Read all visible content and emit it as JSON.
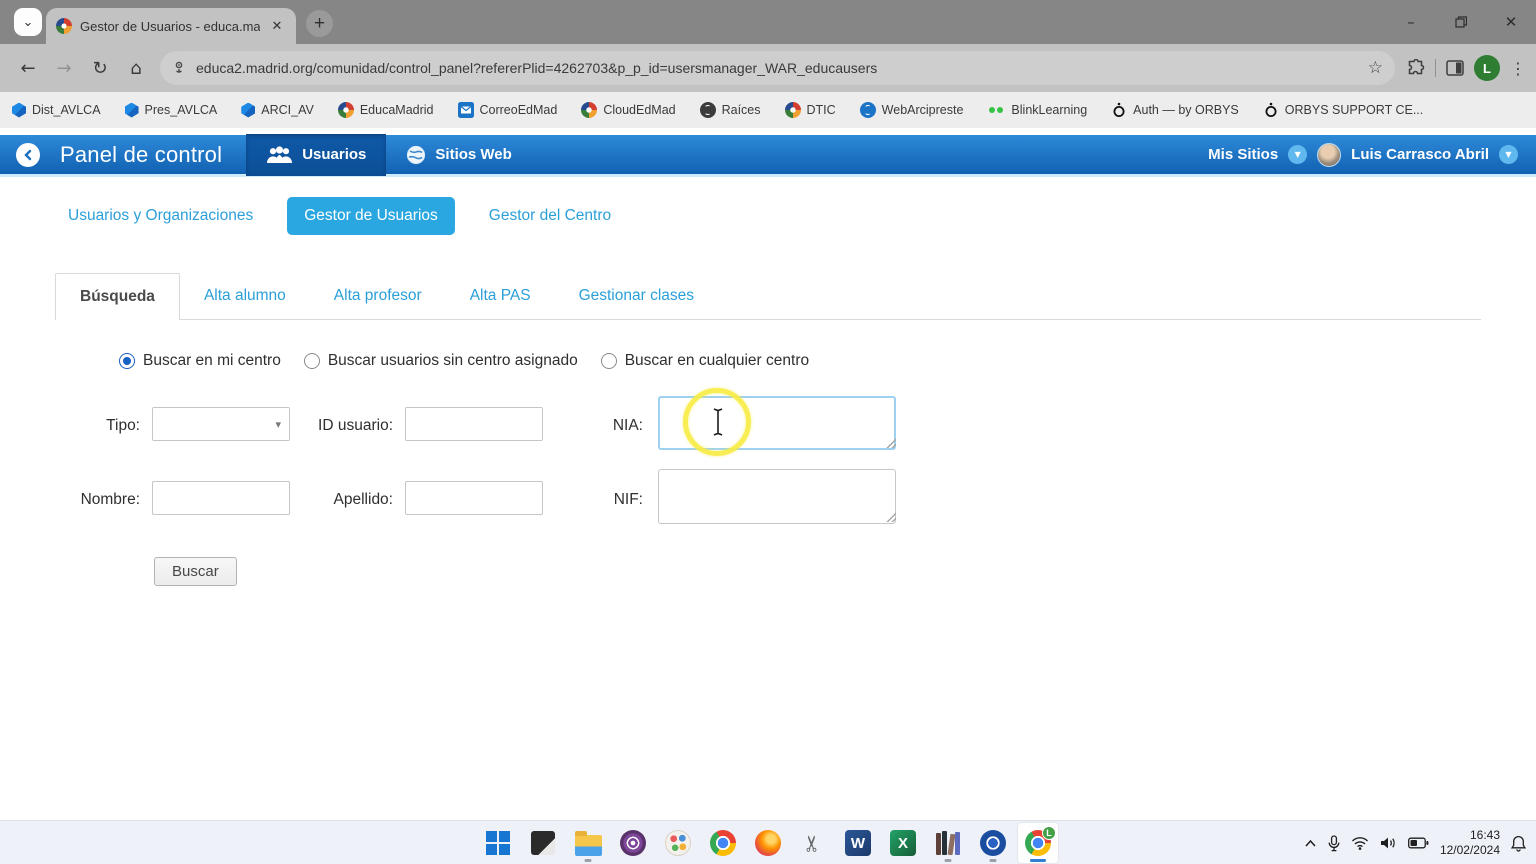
{
  "glyphs": {
    "plus": "+",
    "back_arrow": "←",
    "forward_arrow": "→",
    "reload": "↻",
    "home": "⌂",
    "star": "☆",
    "kebab": "⋮",
    "caret_down": "▼",
    "select_caret": "▾",
    "close": "✕",
    "minimize": "–",
    "tab_caret": "⌄",
    "scissors": "✂"
  },
  "browser": {
    "tab_title": "Gestor de Usuarios - educa.ma",
    "url": "educa2.madrid.org/comunidad/control_panel?refererPlid=4262703&p_p_id=usersmanager_WAR_educausers",
    "profile_initial": "L",
    "bookmarks": [
      {
        "label": "Dist_AVLCA",
        "icon": "folder-bookmark-icon"
      },
      {
        "label": "Pres_AVLCA",
        "icon": "folder-bookmark-icon"
      },
      {
        "label": "ARCI_AV",
        "icon": "folder-bookmark-icon"
      },
      {
        "label": "EducaMadrid",
        "icon": "educamadrid-icon"
      },
      {
        "label": "CorreoEdMad",
        "icon": "mail-icon"
      },
      {
        "label": "CloudEdMad",
        "icon": "educamadrid-icon"
      },
      {
        "label": "Raíces",
        "icon": "globe-dark-icon"
      },
      {
        "label": "DTIC",
        "icon": "educamadrid-icon"
      },
      {
        "label": "WebArcipreste",
        "icon": "globe-blue-icon"
      },
      {
        "label": "BlinkLearning",
        "icon": "blink-icon"
      },
      {
        "label": "Auth — by ORBYS",
        "icon": "orbys-icon"
      },
      {
        "label": "ORBYS SUPPORT CE...",
        "icon": "orbys-icon"
      }
    ]
  },
  "header": {
    "title": "Panel de control",
    "nav": [
      {
        "label": "Usuarios",
        "active": true
      },
      {
        "label": "Sitios Web",
        "active": false
      }
    ],
    "mis_sitios_label": "Mis Sitios",
    "user_name": "Luis Carrasco Abril"
  },
  "subnav": {
    "items": [
      {
        "label": "Usuarios y Organizaciones",
        "active": false
      },
      {
        "label": "Gestor de Usuarios",
        "active": true
      },
      {
        "label": "Gestor del Centro",
        "active": false
      }
    ]
  },
  "tabs": [
    {
      "label": "Búsqueda",
      "active": true
    },
    {
      "label": "Alta alumno",
      "active": false
    },
    {
      "label": "Alta profesor",
      "active": false
    },
    {
      "label": "Alta PAS",
      "active": false
    },
    {
      "label": "Gestionar clases",
      "active": false
    }
  ],
  "search_form": {
    "radios": [
      {
        "label": "Buscar en mi centro",
        "checked": true
      },
      {
        "label": "Buscar usuarios sin centro asignado",
        "checked": false
      },
      {
        "label": "Buscar en cualquier centro",
        "checked": false
      }
    ],
    "labels": {
      "tipo": "Tipo:",
      "id_usuario": "ID usuario:",
      "nia": "NIA:",
      "nombre": "Nombre:",
      "apellido": "Apellido:",
      "nif": "NIF:"
    },
    "values": {
      "tipo": "",
      "id_usuario": "",
      "nia": "",
      "nombre": "",
      "apellido": "",
      "nif": ""
    },
    "submit_label": "Buscar"
  },
  "taskbar": {
    "icons": [
      "start",
      "task-view-dark-window",
      "file-explorer",
      "tor-browser",
      "paint",
      "chrome",
      "firefox",
      "snipping-tool",
      "word",
      "excel",
      "library-books",
      "educamadrid-wheel",
      "chrome-active-profile"
    ],
    "running": [
      "file-explorer",
      "library-books",
      "educamadrid-wheel",
      "chrome-active-profile"
    ],
    "active": "chrome-active-profile",
    "badge_initial": "L",
    "tray": {
      "time": "16:43",
      "date": "12/02/2024"
    }
  },
  "colors": {
    "header_blue_top": "#2e8ad8",
    "header_blue_bottom": "#1161b2",
    "accent_blue": "#2aa7e0",
    "link_blue": "#2b9fd8",
    "focus_border": "#9ed1f0",
    "highlight_yellow": "#f7ec43",
    "titlebar_gray": "#868686",
    "toolbar_gray": "#c2c2c2"
  }
}
